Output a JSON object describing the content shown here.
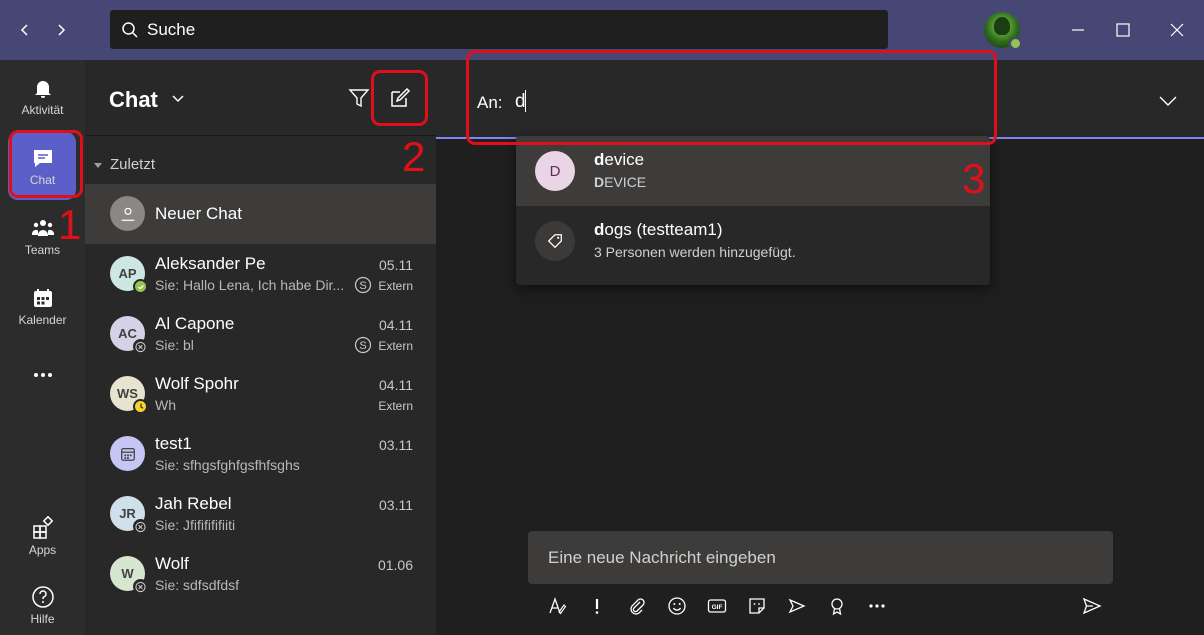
{
  "titlebar": {
    "search_placeholder": "Suche"
  },
  "rail": {
    "items": [
      {
        "label": "Aktivität",
        "icon": "bell-icon"
      },
      {
        "label": "Chat",
        "icon": "chat-icon"
      },
      {
        "label": "Teams",
        "icon": "teams-icon"
      },
      {
        "label": "Kalender",
        "icon": "calendar-icon"
      },
      {
        "label": "Apps",
        "icon": "apps-icon"
      },
      {
        "label": "Hilfe",
        "icon": "help-icon"
      }
    ]
  },
  "list": {
    "title": "Chat",
    "section": "Zuletzt",
    "new_chat": "Neuer Chat",
    "chats": [
      {
        "initials": "AP",
        "name": "Aleksander Pe",
        "preview": "Sie: Hallo Lena, Ich habe Dir...",
        "date": "05.11",
        "tag": "Extern",
        "status": "available"
      },
      {
        "initials": "AC",
        "name": "Al Capone",
        "preview": "Sie: bl",
        "date": "04.11",
        "tag": "Extern",
        "status": "offline"
      },
      {
        "initials": "WS",
        "name": "Wolf Spohr",
        "preview": "Wh",
        "date": "04.11",
        "tag": "Extern",
        "status": "away"
      },
      {
        "initials": "",
        "name": "test1",
        "preview": "Sie: sfhgsfghfgsfhfsghs",
        "date": "03.11",
        "tag": "",
        "status": "meeting"
      },
      {
        "initials": "JR",
        "name": "Jah Rebel",
        "preview": "Sie: Jfififififiiti",
        "date": "03.11",
        "tag": "",
        "status": "offline"
      },
      {
        "initials": "W",
        "name": "Wolf",
        "preview": "Sie: sdfsdfdsf",
        "date": "01.06",
        "tag": "",
        "status": "offline"
      }
    ]
  },
  "main": {
    "to_label": "An:",
    "to_value": "d",
    "suggestions": [
      {
        "initial": "D",
        "title_bold": "d",
        "title_rest": "evice",
        "sub_bold": "D",
        "sub_rest": "EVICE"
      },
      {
        "icon": "tag-icon",
        "title_bold": "d",
        "title_rest": "ogs (testteam1)",
        "sub": "3 Personen werden hinzugefügt."
      }
    ],
    "compose_placeholder": "Eine neue Nachricht eingeben"
  },
  "annotations": [
    "1",
    "2",
    "3"
  ],
  "colors": {
    "accent": "#7f85f5",
    "titlebar": "#464775",
    "annotation": "#e0101b"
  }
}
